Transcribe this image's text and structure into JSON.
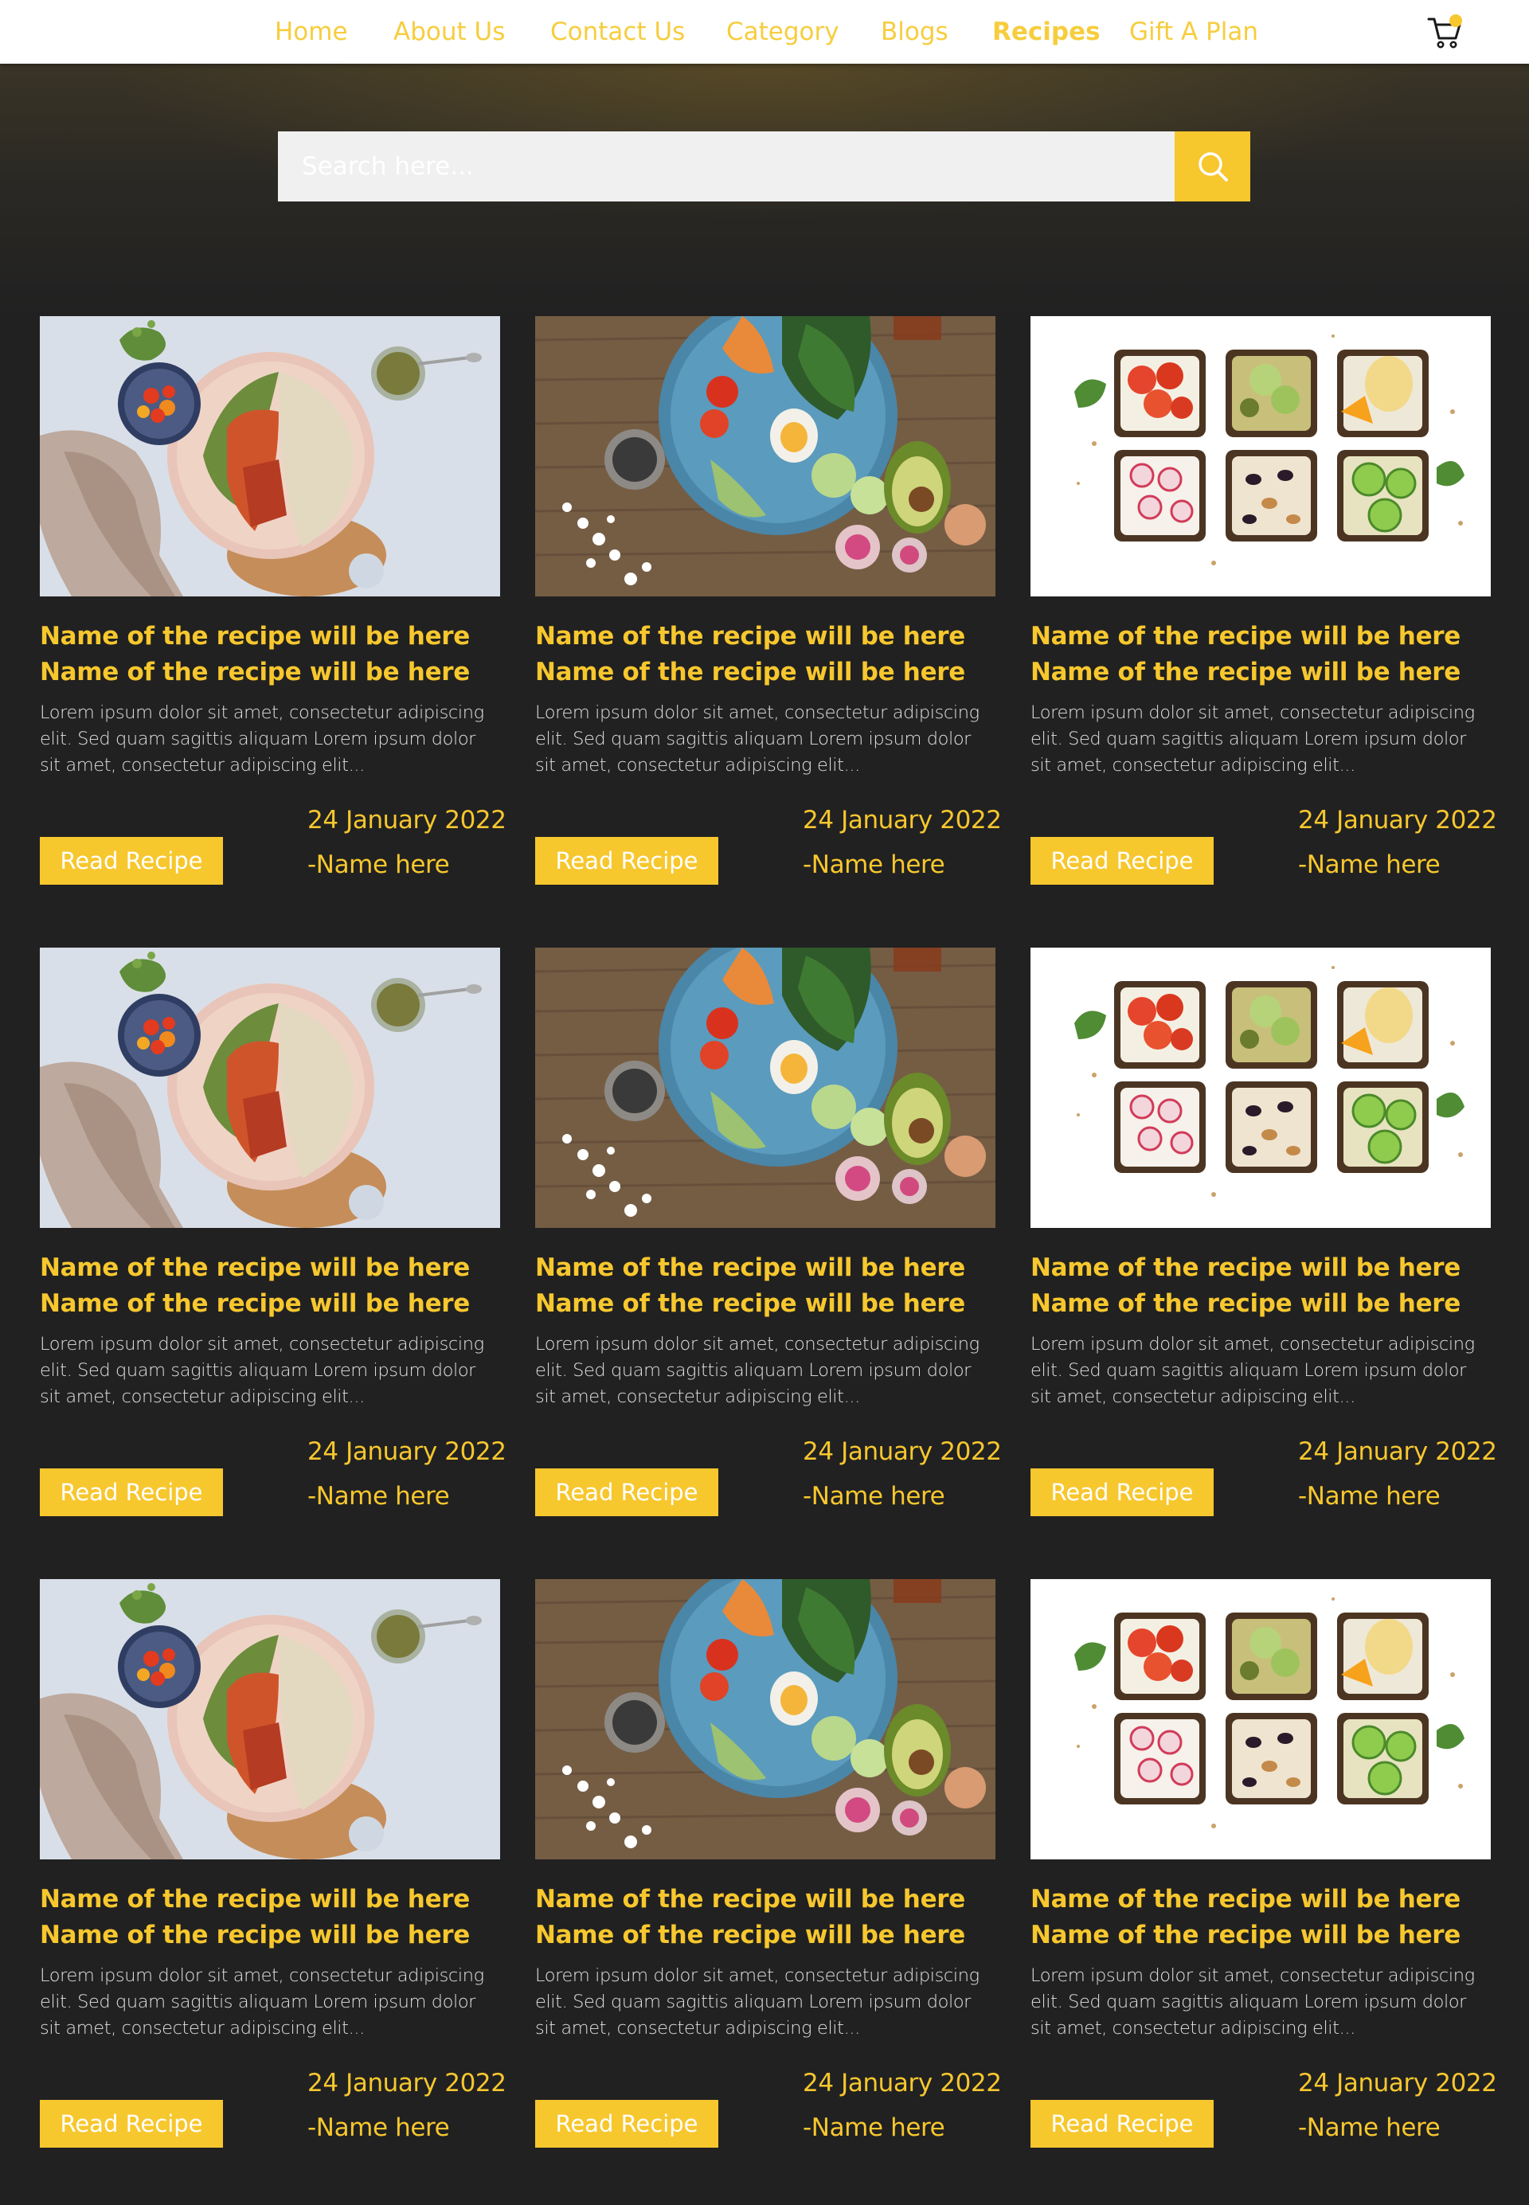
{
  "nav": {
    "items": [
      {
        "label": "Home",
        "active": false
      },
      {
        "label": "About Us",
        "active": false
      },
      {
        "label": "Contact Us",
        "active": false
      },
      {
        "label": "Category",
        "active": false
      },
      {
        "label": "Blogs",
        "active": false
      },
      {
        "label": "Recipes",
        "active": true
      },
      {
        "label": "Gift A Plan",
        "active": false
      }
    ],
    "cart_icon": "cart-icon",
    "cart_has_badge": true
  },
  "search": {
    "placeholder": "Search here...",
    "value": "",
    "button_icon": "search-icon"
  },
  "colors": {
    "accent": "#f7c72e",
    "background": "#212121",
    "nav_background": "#ffffff"
  },
  "recipes": [
    {
      "image": "salmon-quinoa-bowl",
      "title": "Name of the recipe will be here Name of the recipe will be here",
      "description": "Lorem ipsum dolor sit amet, consectetur adipiscing elit. Sed quam sagittis aliquam Lorem ipsum dolor sit amet, consectetur adipiscing elit...",
      "button": "Read Recipe",
      "date": "24 January 2022",
      "author": "-Name here"
    },
    {
      "image": "egg-salad-bowl",
      "title": "Name of the recipe will be here Name of the recipe will be here",
      "description": "Lorem ipsum dolor sit amet, consectetur adipiscing elit. Sed quam sagittis aliquam Lorem ipsum dolor sit amet, consectetur adipiscing elit...",
      "button": "Read Recipe",
      "date": "24 January 2022",
      "author": "-Name here"
    },
    {
      "image": "toast-platter",
      "title": "Name of the recipe will be here Name of the recipe will be here",
      "description": "Lorem ipsum dolor sit amet, consectetur adipiscing elit. Sed quam sagittis aliquam Lorem ipsum dolor sit amet, consectetur adipiscing elit...",
      "button": "Read Recipe",
      "date": "24 January 2022",
      "author": "-Name here"
    },
    {
      "image": "salmon-quinoa-bowl",
      "title": "Name of the recipe will be here Name of the recipe will be here",
      "description": "Lorem ipsum dolor sit amet, consectetur adipiscing elit. Sed quam sagittis aliquam Lorem ipsum dolor sit amet, consectetur adipiscing elit...",
      "button": "Read Recipe",
      "date": "24 January 2022",
      "author": "-Name here"
    },
    {
      "image": "egg-salad-bowl",
      "title": "Name of the recipe will be here Name of the recipe will be here",
      "description": "Lorem ipsum dolor sit amet, consectetur adipiscing elit. Sed quam sagittis aliquam Lorem ipsum dolor sit amet, consectetur adipiscing elit...",
      "button": "Read Recipe",
      "date": "24 January 2022",
      "author": "-Name here"
    },
    {
      "image": "toast-platter",
      "title": "Name of the recipe will be here Name of the recipe will be here",
      "description": "Lorem ipsum dolor sit amet, consectetur adipiscing elit. Sed quam sagittis aliquam Lorem ipsum dolor sit amet, consectetur adipiscing elit...",
      "button": "Read Recipe",
      "date": "24 January 2022",
      "author": "-Name here"
    },
    {
      "image": "salmon-quinoa-bowl",
      "title": "Name of the recipe will be here Name of the recipe will be here",
      "description": "Lorem ipsum dolor sit amet, consectetur adipiscing elit. Sed quam sagittis aliquam Lorem ipsum dolor sit amet, consectetur adipiscing elit...",
      "button": "Read Recipe",
      "date": "24 January 2022",
      "author": "-Name here"
    },
    {
      "image": "egg-salad-bowl",
      "title": "Name of the recipe will be here Name of the recipe will be here",
      "description": "Lorem ipsum dolor sit amet, consectetur adipiscing elit. Sed quam sagittis aliquam Lorem ipsum dolor sit amet, consectetur adipiscing elit...",
      "button": "Read Recipe",
      "date": "24 January 2022",
      "author": "-Name here"
    },
    {
      "image": "toast-platter",
      "title": "Name of the recipe will be here Name of the recipe will be here",
      "description": "Lorem ipsum dolor sit amet, consectetur adipiscing elit. Sed quam sagittis aliquam Lorem ipsum dolor sit amet, consectetur adipiscing elit...",
      "button": "Read Recipe",
      "date": "24 January 2022",
      "author": "-Name here"
    }
  ]
}
